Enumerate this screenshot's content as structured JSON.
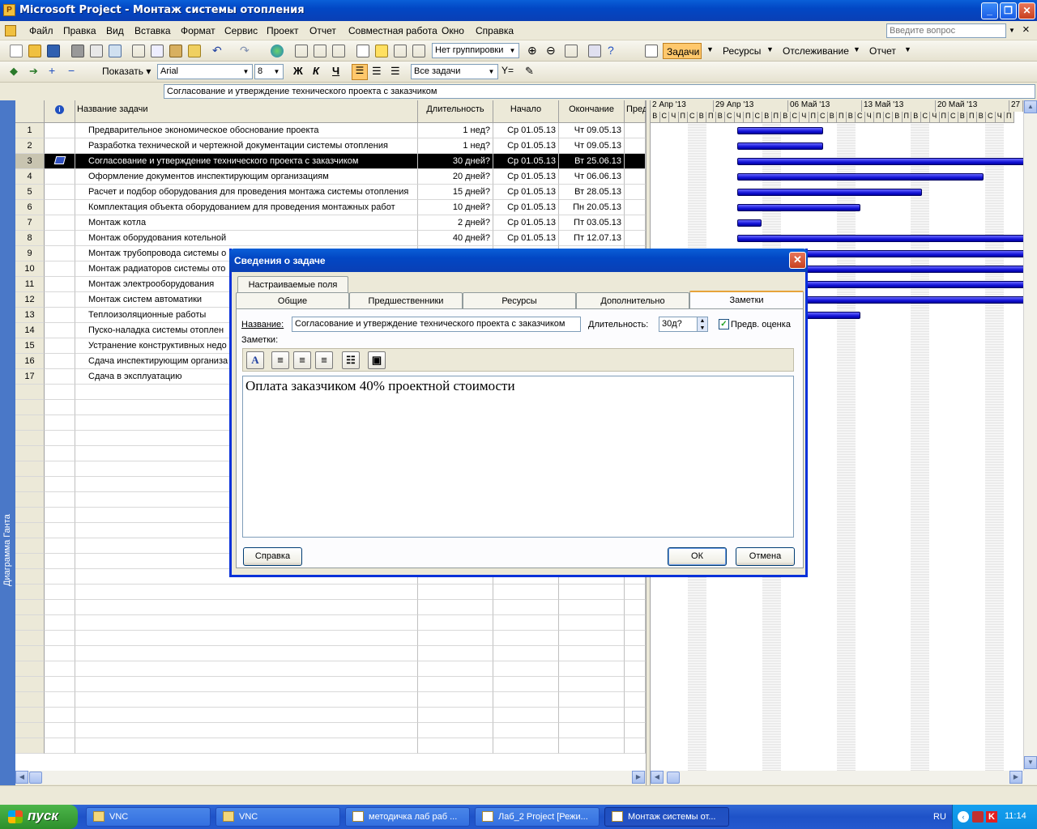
{
  "window": {
    "title": "Microsoft Project - Монтаж системы отопления",
    "min_label": "_",
    "max_label": "❐",
    "close_label": "✕"
  },
  "menu": {
    "items": [
      "Файл",
      "Правка",
      "Вид",
      "Вставка",
      "Формат",
      "Сервис",
      "Проект",
      "Отчет",
      "Совместная работа",
      "Окно",
      "Справка"
    ],
    "ask_placeholder": "Введите вопрос",
    "doc_close": "×"
  },
  "toolbar1": {
    "grouping": "Нет группировки",
    "task_views": [
      "Задачи",
      "Ресурсы",
      "Отслеживание",
      "Отчет"
    ]
  },
  "toolbar2": {
    "show_label": "Показать",
    "font": "Arial",
    "size": "8",
    "bold": "Ж",
    "italic": "К",
    "underline": "Ч",
    "filter": "Все задачи"
  },
  "entry_value": "Согласование и утверждение технического проекта с заказчиком",
  "viewbar_label": "Диаграмма Ганта",
  "table": {
    "headers": {
      "name": "Название задачи",
      "duration": "Длительность",
      "start": "Начало",
      "finish": "Окончание",
      "pred": "Пред"
    },
    "rows": [
      {
        "id": "1",
        "name": "Предварительное экономическое обоснование проекта",
        "duration": "1 нед?",
        "start": "Ср 01.05.13",
        "finish": "Чт 09.05.13"
      },
      {
        "id": "2",
        "name": "Разработка технической и чертежной документации системы отопления",
        "duration": "1 нед?",
        "start": "Ср 01.05.13",
        "finish": "Чт 09.05.13"
      },
      {
        "id": "3",
        "name": "Согласование и утверждение технического проекта с заказчиком",
        "duration": "30 дней?",
        "start": "Ср 01.05.13",
        "finish": "Вт 25.06.13"
      },
      {
        "id": "4",
        "name": "Оформление документов инспектирующим организациям",
        "duration": "20 дней?",
        "start": "Ср 01.05.13",
        "finish": "Чт 06.06.13"
      },
      {
        "id": "5",
        "name": "Расчет и подбор оборудования для проведения монтажа системы отопления",
        "duration": "15 дней?",
        "start": "Ср 01.05.13",
        "finish": "Вт 28.05.13"
      },
      {
        "id": "6",
        "name": "Комплектация объекта оборудованием для проведения монтажных работ",
        "duration": "10 дней?",
        "start": "Ср 01.05.13",
        "finish": "Пн 20.05.13"
      },
      {
        "id": "7",
        "name": "Монтаж котла",
        "duration": "2 дней?",
        "start": "Ср 01.05.13",
        "finish": "Пт 03.05.13"
      },
      {
        "id": "8",
        "name": "Монтаж оборудования котельной",
        "duration": "40 дней?",
        "start": "Ср 01.05.13",
        "finish": "Пт 12.07.13"
      },
      {
        "id": "9",
        "name": "Монтаж трубопровода системы о",
        "duration": "",
        "start": "",
        "finish": ""
      },
      {
        "id": "10",
        "name": "Монтаж радиаторов системы ото",
        "duration": "",
        "start": "",
        "finish": ""
      },
      {
        "id": "11",
        "name": "Монтаж электрооборудования",
        "duration": "",
        "start": "",
        "finish": ""
      },
      {
        "id": "12",
        "name": "Монтаж систем автоматики",
        "duration": "",
        "start": "",
        "finish": ""
      },
      {
        "id": "13",
        "name": "Теплоизоляционные работы",
        "duration": "",
        "start": "",
        "finish": ""
      },
      {
        "id": "14",
        "name": "Пуско-наладка системы отоплен",
        "duration": "",
        "start": "",
        "finish": ""
      },
      {
        "id": "15",
        "name": "Устранение конструктивных недо",
        "duration": "",
        "start": "",
        "finish": ""
      },
      {
        "id": "16",
        "name": "Сдача инспектирующим организа",
        "duration": "",
        "start": "",
        "finish": ""
      },
      {
        "id": "17",
        "name": "Сдача в эксплуатацию",
        "duration": "",
        "start": "",
        "finish": ""
      }
    ]
  },
  "gantt": {
    "weeks": [
      "2 Апр '13",
      "29 Апр '13",
      "06 Май '13",
      "13 Май '13",
      "20 Май '13",
      "27"
    ],
    "days": [
      "В",
      "С",
      "Ч",
      "П",
      "С",
      "В",
      "П",
      "В",
      "С",
      "Ч",
      "П",
      "С",
      "В",
      "П",
      "В",
      "С",
      "Ч",
      "П",
      "С",
      "В",
      "П",
      "В",
      "С",
      "Ч",
      "П",
      "С",
      "В",
      "П",
      "В",
      "С",
      "Ч",
      "П",
      "С",
      "В",
      "П",
      "В",
      "С",
      "Ч",
      "П"
    ],
    "bars_days": [
      7,
      7,
      30,
      20,
      15,
      10,
      2,
      40,
      30,
      30,
      30,
      30,
      10,
      4,
      4,
      4
    ]
  },
  "dialog": {
    "title": "Сведения о задаче",
    "close_label": "✕",
    "tab_custom": "Настраиваемые поля",
    "tabs": [
      "Общие",
      "Предшественники",
      "Ресурсы",
      "Дополнительно",
      "Заметки"
    ],
    "name_label": "Название:",
    "name_value": "Согласование и утверждение технического проекта с заказчиком",
    "duration_label": "Длительность:",
    "duration_value": "30д?",
    "estimated_label": "Предв. оценка",
    "estimated_checked": true,
    "notes_label": "Заметки:",
    "notes_text": "Оплата заказчиком 40% проектной стоимости",
    "help_label": "Справка",
    "ok_label": "ОК",
    "cancel_label": "Отмена"
  },
  "taskbar": {
    "start_label": "пуск",
    "tasks": [
      "VNC",
      "VNC",
      "методичка лаб раб ...",
      "Лаб_2 Project [Режи...",
      "Монтаж системы от..."
    ],
    "lang": "RU",
    "time": "11:14"
  }
}
